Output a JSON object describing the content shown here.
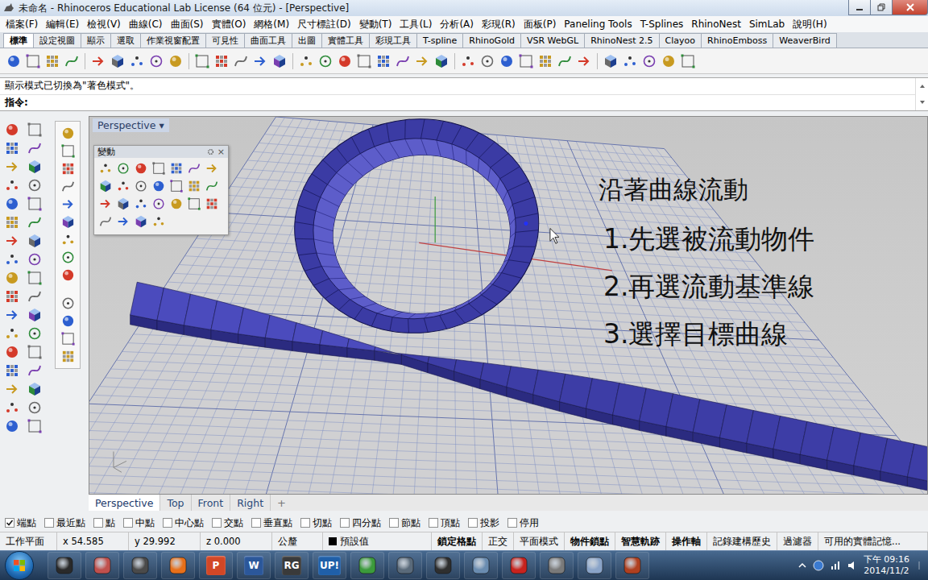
{
  "window": {
    "title": "未命名 - Rhinoceros Educational Lab License (64 位元) - [Perspective]"
  },
  "menu": [
    "檔案(F)",
    "編輯(E)",
    "檢視(V)",
    "曲線(C)",
    "曲面(S)",
    "實體(O)",
    "網格(M)",
    "尺寸標註(D)",
    "變動(T)",
    "工具(L)",
    "分析(A)",
    "彩現(R)",
    "面板(P)",
    "Paneling Tools",
    "T-Splines",
    "RhinoNest",
    "SimLab",
    "說明(H)"
  ],
  "toolbar_tabs": [
    {
      "label": "標準",
      "selected": true
    },
    {
      "label": "設定視圖",
      "selected": false
    },
    {
      "label": "顯示",
      "selected": false
    },
    {
      "label": "選取",
      "selected": false
    },
    {
      "label": "作業視窗配置",
      "selected": false
    },
    {
      "label": "可見性",
      "selected": false
    },
    {
      "label": "曲面工具",
      "selected": false
    },
    {
      "label": "出圖",
      "selected": false
    },
    {
      "label": "實體工具",
      "selected": false
    },
    {
      "label": "彩現工具",
      "selected": false
    },
    {
      "label": "T-spline",
      "selected": false
    },
    {
      "label": "RhinoGold",
      "selected": false
    },
    {
      "label": "VSR WebGL",
      "selected": false
    },
    {
      "label": "RhinoNest 2.5",
      "selected": false
    },
    {
      "label": "Clayoo",
      "selected": false
    },
    {
      "label": "RhinoEmboss",
      "selected": false
    },
    {
      "label": "WeaverBird",
      "selected": false
    }
  ],
  "command": {
    "history": "顯示模式已切換為\"著色模式\"。",
    "prompt": "指令:"
  },
  "viewport": {
    "title": "Perspective",
    "caret": "▾"
  },
  "transform_panel": {
    "title": "變動",
    "close": "×"
  },
  "annotation": {
    "heading": "沿著曲線流動",
    "steps": [
      "1.先選被流動物件",
      "2.再選流動基準線",
      "3.選擇目標曲線"
    ]
  },
  "view_tabs": [
    {
      "label": "Perspective",
      "selected": true
    },
    {
      "label": "Top",
      "selected": false
    },
    {
      "label": "Front",
      "selected": false
    },
    {
      "label": "Right",
      "selected": false
    }
  ],
  "add_tab": "+",
  "osnaps": [
    {
      "label": "端點",
      "checked": true
    },
    {
      "label": "最近點",
      "checked": false
    },
    {
      "label": "點",
      "checked": false
    },
    {
      "label": "中點",
      "checked": false
    },
    {
      "label": "中心點",
      "checked": false
    },
    {
      "label": "交點",
      "checked": false
    },
    {
      "label": "垂直點",
      "checked": false
    },
    {
      "label": "切點",
      "checked": false
    },
    {
      "label": "四分點",
      "checked": false
    },
    {
      "label": "節點",
      "checked": false
    },
    {
      "label": "頂點",
      "checked": false
    },
    {
      "label": "投影",
      "checked": false
    },
    {
      "label": "停用",
      "checked": false
    }
  ],
  "status": {
    "cplane": "工作平面",
    "x": "x 54.585",
    "y": "y 29.992",
    "z": "z 0.000",
    "units": "公釐",
    "layer": "預設值",
    "toggles": [
      {
        "label": "鎖定格點",
        "on": true
      },
      {
        "label": "正交",
        "on": false
      },
      {
        "label": "平面模式",
        "on": false
      },
      {
        "label": "物件鎖點",
        "on": true
      },
      {
        "label": "智慧軌跡",
        "on": true
      },
      {
        "label": "操作軸",
        "on": true
      },
      {
        "label": "記錄建構歷史",
        "on": false
      },
      {
        "label": "過濾器",
        "on": false
      }
    ],
    "memory": "可用的實體記憶..."
  },
  "taskbar": {
    "apps": [
      {
        "kind": "icon",
        "label": "",
        "color": "#2a2a2a"
      },
      {
        "kind": "icon",
        "label": "",
        "color": "#c0504d"
      },
      {
        "kind": "icon",
        "label": "",
        "color": "#4a4a4a"
      },
      {
        "kind": "icon",
        "label": "",
        "color": "#e8701a"
      },
      {
        "kind": "text",
        "label": "P",
        "color": "#d24726"
      },
      {
        "kind": "text",
        "label": "W",
        "color": "#2b579a"
      },
      {
        "kind": "text",
        "label": "RG",
        "color": "#3a3a3a"
      },
      {
        "kind": "text",
        "label": "UP!",
        "color": "#1f5fa8"
      },
      {
        "kind": "icon",
        "label": "",
        "color": "#3c9b3c"
      },
      {
        "kind": "icon",
        "label": "",
        "color": "#5a6a7a"
      },
      {
        "kind": "icon",
        "label": "",
        "color": "#2f2f2f"
      },
      {
        "kind": "icon",
        "label": "",
        "color": "#6a8cb0"
      },
      {
        "kind": "icon",
        "label": "",
        "color": "#c8231e"
      },
      {
        "kind": "icon",
        "label": "",
        "color": "#7a7a7a"
      },
      {
        "kind": "icon",
        "label": "",
        "color": "#8aa4c8"
      },
      {
        "kind": "icon",
        "label": "",
        "color": "#b04020"
      }
    ],
    "time": "下午 09:16",
    "date": "2014/11/2"
  }
}
